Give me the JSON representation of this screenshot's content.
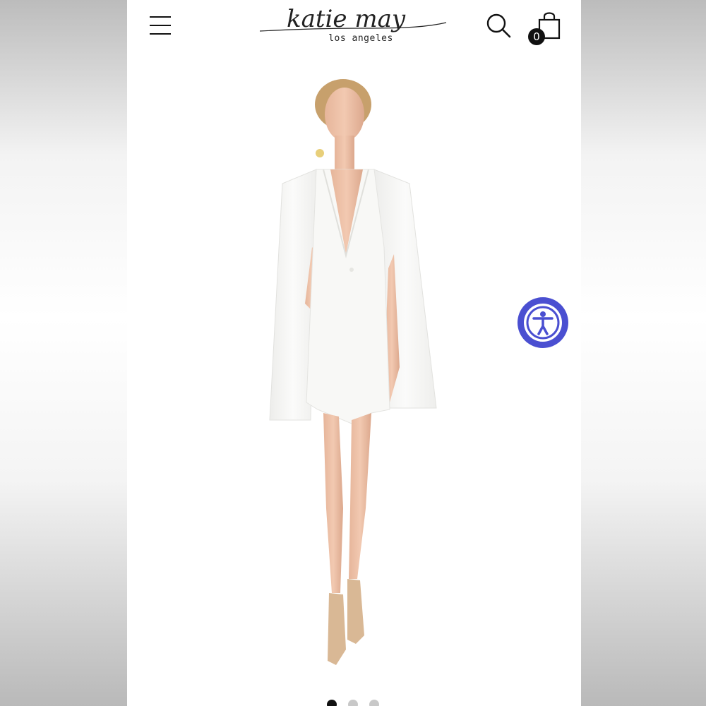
{
  "header": {
    "brand_name": "katie may",
    "brand_tagline": "los angeles",
    "menu_icon": "hamburger-menu-icon",
    "search_icon": "search-icon",
    "cart_icon": "shopping-bag-icon",
    "cart_count": "0"
  },
  "product_image": {
    "subject": "model in white cape blazer dress"
  },
  "accessibility": {
    "icon": "accessibility-person-icon",
    "accent_color": "#4a4fd1"
  },
  "carousel": {
    "dot_count": 3,
    "active_index": 0
  },
  "colors": {
    "page_background": "#ffffff",
    "icon_color": "#111111"
  }
}
